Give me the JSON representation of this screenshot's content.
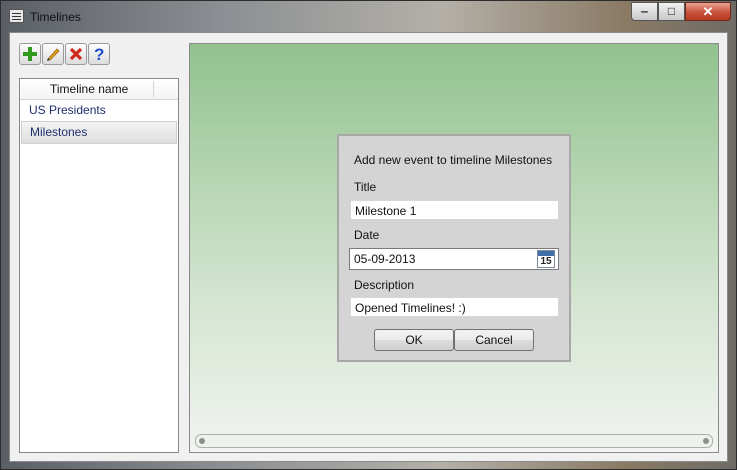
{
  "window": {
    "title": "Timelines"
  },
  "toolbar": {
    "buttons": [
      {
        "name": "add-timeline",
        "icon": "plus-icon",
        "color": "#2f9a1d"
      },
      {
        "name": "edit-timeline",
        "icon": "pencil-icon",
        "color": "#e0a020"
      },
      {
        "name": "delete-timeline",
        "icon": "close-x-icon",
        "color": "#d0281c"
      },
      {
        "name": "help",
        "icon": "question-icon",
        "color": "#1f4fc8"
      }
    ]
  },
  "timeline_list": {
    "column_header": "Timeline name",
    "items": [
      "US Presidents",
      "Milestones"
    ],
    "selected": "Milestones"
  },
  "dialog": {
    "heading": "Add new event to timeline Milestones",
    "title_label": "Title",
    "title_value": "Milestone 1",
    "date_label": "Date",
    "date_value": "05-09-2013",
    "calendar_day": "15",
    "description_label": "Description",
    "description_value": "Opened Timelines! :)",
    "ok_label": "OK",
    "cancel_label": "Cancel"
  }
}
